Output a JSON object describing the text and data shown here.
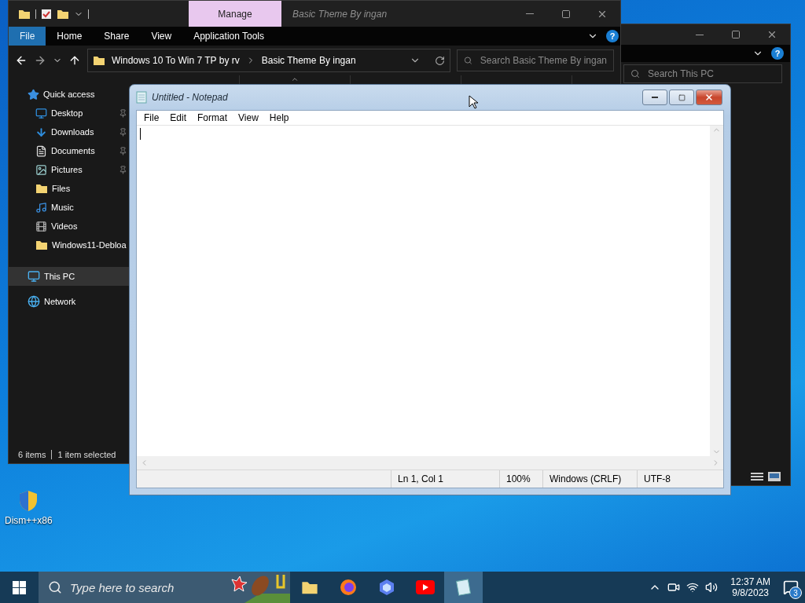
{
  "desktop_icons": [
    {
      "label": "Dism++x86"
    }
  ],
  "back_window": {
    "help": "?",
    "search": {
      "placeholder": "Search This PC"
    }
  },
  "explorer": {
    "context_tab": "Manage",
    "title": "Basic Theme By ingan",
    "help": "?",
    "ribbon_tabs": [
      {
        "label": "File",
        "selected": true
      },
      {
        "label": "Home",
        "selected": false
      },
      {
        "label": "Share",
        "selected": false
      },
      {
        "label": "View",
        "selected": false
      },
      {
        "label": "Application Tools",
        "selected": false
      }
    ],
    "address": {
      "crumbs": [
        "Windows 10 To Win 7 TP by rv",
        "Basic Theme By ingan"
      ]
    },
    "search": {
      "placeholder": "Search Basic Theme By ingan"
    },
    "sidebar": {
      "items": [
        {
          "label": "Quick access",
          "selected": false,
          "children": [
            {
              "label": "Desktop",
              "pinned": true,
              "selected": false
            },
            {
              "label": "Downloads",
              "pinned": true,
              "selected": false
            },
            {
              "label": "Documents",
              "pinned": true,
              "selected": false
            },
            {
              "label": "Pictures",
              "pinned": true,
              "selected": false
            },
            {
              "label": "Files",
              "pinned": false,
              "selected": false
            },
            {
              "label": "Music",
              "pinned": false,
              "selected": false
            },
            {
              "label": "Videos",
              "pinned": false,
              "selected": false
            },
            {
              "label": "Windows11-Debloa",
              "pinned": false,
              "selected": false
            }
          ]
        },
        {
          "label": "This PC",
          "selected": true
        },
        {
          "label": "Network",
          "selected": false
        }
      ]
    },
    "status_bar": [
      "6 items",
      "1 item selected"
    ]
  },
  "notepad": {
    "title": "Untitled - Notepad",
    "menu": [
      "File",
      "Edit",
      "Format",
      "View",
      "Help"
    ],
    "status_bar": [
      "Ln 1, Col 1",
      "100%",
      "Windows (CRLF)",
      "UTF-8"
    ]
  },
  "taskbar": {
    "search": {
      "placeholder": "Type here to search"
    },
    "apps": [
      {
        "selected": false
      },
      {
        "selected": false
      },
      {
        "selected": false
      },
      {
        "selected": false
      },
      {
        "selected": true
      }
    ],
    "time": "12:37 AM",
    "date": "9/8/2023",
    "notifications": "3"
  }
}
